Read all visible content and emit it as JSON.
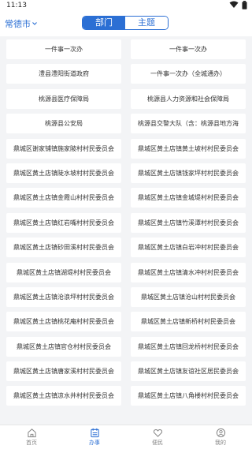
{
  "status": {
    "time": "11:13"
  },
  "header": {
    "city": "常德市",
    "segments": [
      {
        "label": "部门"
      },
      {
        "label": "主题"
      }
    ]
  },
  "grid": {
    "items": [
      "一件事一次办",
      "一件事一次办",
      "澧县澧阳街道政府",
      "一件事一次办（全城通办）",
      "桃源县医疗保障局",
      "桃源县人力资源和社会保障局",
      "桃源县公安局",
      "桃源县交警大队（含：桃源县地方海",
      "鼎城区谢家铺镇施家陂村村民委员会",
      "鼎城区黄土店镇黄土坡村村民委员会",
      "鼎城区黄土店镇陡水坡村村民委员会",
      "鼎城区黄土店镇钱家坪村村民委员会",
      "鼎城区黄土店镇金霞山村村民委员会",
      "鼎城区黄土店镇金城堤村村民委员会",
      "鼎城区黄土店镇红岩嘴村村民委员会",
      "鼎城区黄土店镇竹溪潭村村民委员会",
      "鼎城区黄土店镇砂田溪村村民委员会",
      "鼎城区黄土店镇白岩冲村村民委员会",
      "鼎城区黄土店镇湖堤村村民委员会",
      "鼎城区黄土店镇清水冲村村民委员会",
      "鼎城区黄土店镇沧浪坪村村民委员会",
      "鼎城区黄土店镇沧山村村民委员会",
      "鼎城区黄土店镇桃花庵村村民委员会",
      "鼎城区黄土店镇新桥村村民委员会",
      "鼎城区黄土店镇官仓村村民委员会",
      "鼎城区黄土店镇回龙桥村村民委员会",
      "鼎城区黄土店镇唐家溪村村民委员会",
      "鼎城区黄土店镇友谊社区居民委员会",
      "鼎城区黄土店镇凉水井村村民委员会",
      "鼎城区黄土店镇八角楼村村民委员会"
    ]
  },
  "tabbar": {
    "items": [
      {
        "label": "首页",
        "icon": "home-icon"
      },
      {
        "label": "办事",
        "icon": "service-icon"
      },
      {
        "label": "便民",
        "icon": "heart-icon"
      },
      {
        "label": "我的",
        "icon": "profile-icon"
      }
    ]
  },
  "colors": {
    "accent": "#2b6fd4",
    "background": "#f3f4f6"
  }
}
